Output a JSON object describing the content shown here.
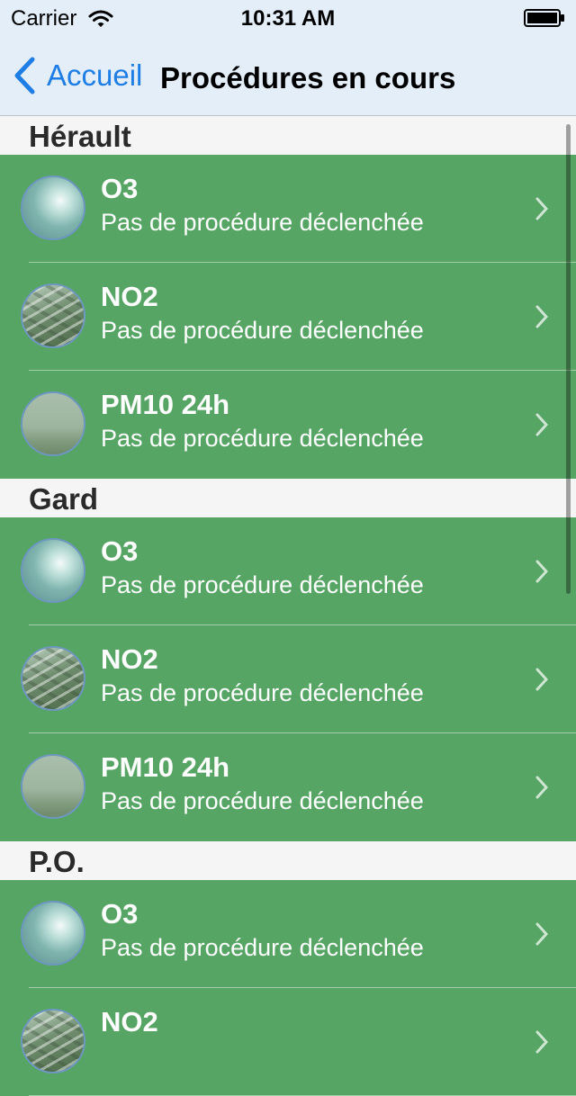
{
  "status_bar": {
    "carrier": "Carrier",
    "time": "10:31 AM"
  },
  "nav": {
    "back_label": "Accueil",
    "title": "Procédures en cours"
  },
  "sections": [
    {
      "title": "Hérault",
      "rows": [
        {
          "title": "O3",
          "subtitle": "Pas de procédure déclenchée",
          "icon": "sun-haze"
        },
        {
          "title": "NO2",
          "subtitle": "Pas de procédure déclenchée",
          "icon": "road-traffic"
        },
        {
          "title": "PM10 24h",
          "subtitle": "Pas de procédure déclenchée",
          "icon": "city-haze"
        }
      ]
    },
    {
      "title": "Gard",
      "rows": [
        {
          "title": "O3",
          "subtitle": "Pas de procédure déclenchée",
          "icon": "sun-haze"
        },
        {
          "title": "NO2",
          "subtitle": "Pas de procédure déclenchée",
          "icon": "road-traffic"
        },
        {
          "title": "PM10 24h",
          "subtitle": "Pas de procédure déclenchée",
          "icon": "city-haze"
        }
      ]
    },
    {
      "title": "P.O.",
      "rows": [
        {
          "title": "O3",
          "subtitle": "Pas de procédure déclenchée",
          "icon": "sun-haze"
        },
        {
          "title": "NO2",
          "subtitle": "",
          "icon": "road-traffic"
        }
      ]
    }
  ],
  "colors": {
    "row_background": "#56a564",
    "accent": "#1e7ee6",
    "nav_background": "#e3eef8"
  }
}
